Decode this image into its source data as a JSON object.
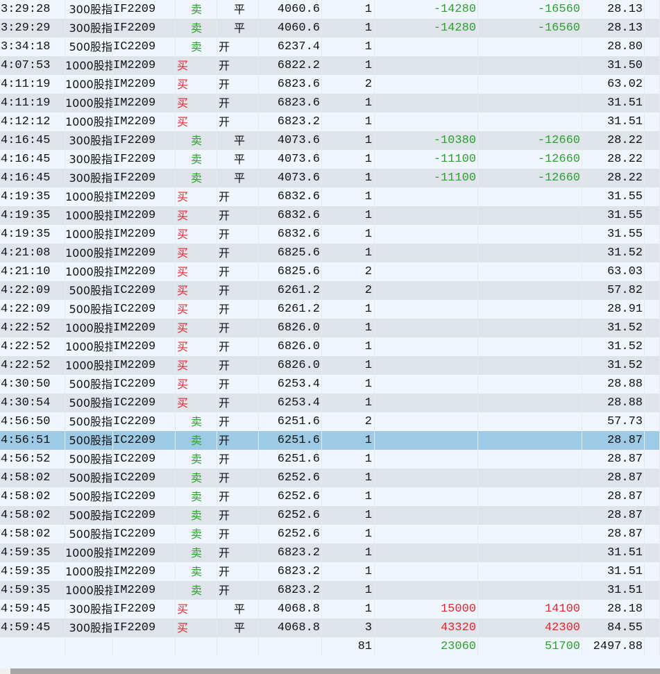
{
  "colors": {
    "buy": "#e8242a",
    "sell": "#2ea02e"
  },
  "rows": [
    [
      "3:29:28",
      "300股指",
      "IF2209",
      "卖",
      "平",
      "4060.6",
      "1",
      "-14280",
      "-16560",
      "28.13"
    ],
    [
      "3:29:29",
      "300股指",
      "IF2209",
      "卖",
      "平",
      "4060.6",
      "1",
      "-14280",
      "-16560",
      "28.13"
    ],
    [
      "3:34:18",
      "500股指",
      "IC2209",
      "卖",
      "开",
      "6237.4",
      "1",
      "",
      "",
      "28.80"
    ],
    [
      "4:07:53",
      "1000股指",
      "IM2209",
      "买",
      "开",
      "6822.2",
      "1",
      "",
      "",
      "31.50"
    ],
    [
      "4:11:19",
      "1000股指",
      "IM2209",
      "买",
      "开",
      "6823.6",
      "2",
      "",
      "",
      "63.02"
    ],
    [
      "4:11:19",
      "1000股指",
      "IM2209",
      "买",
      "开",
      "6823.6",
      "1",
      "",
      "",
      "31.51"
    ],
    [
      "4:12:12",
      "1000股指",
      "IM2209",
      "买",
      "开",
      "6823.2",
      "1",
      "",
      "",
      "31.51"
    ],
    [
      "4:16:45",
      "300股指",
      "IF2209",
      "卖",
      "平",
      "4073.6",
      "1",
      "-10380",
      "-12660",
      "28.22"
    ],
    [
      "4:16:45",
      "300股指",
      "IF2209",
      "卖",
      "平",
      "4073.6",
      "1",
      "-11100",
      "-12660",
      "28.22"
    ],
    [
      "4:16:45",
      "300股指",
      "IF2209",
      "卖",
      "平",
      "4073.6",
      "1",
      "-11100",
      "-12660",
      "28.22"
    ],
    [
      "4:19:35",
      "1000股指",
      "IM2209",
      "买",
      "开",
      "6832.6",
      "1",
      "",
      "",
      "31.55"
    ],
    [
      "4:19:35",
      "1000股指",
      "IM2209",
      "买",
      "开",
      "6832.6",
      "1",
      "",
      "",
      "31.55"
    ],
    [
      "4:19:35",
      "1000股指",
      "IM2209",
      "买",
      "开",
      "6832.6",
      "1",
      "",
      "",
      "31.55"
    ],
    [
      "4:21:08",
      "1000股指",
      "IM2209",
      "买",
      "开",
      "6825.6",
      "1",
      "",
      "",
      "31.52"
    ],
    [
      "4:21:10",
      "1000股指",
      "IM2209",
      "买",
      "开",
      "6825.6",
      "2",
      "",
      "",
      "63.03"
    ],
    [
      "4:22:09",
      "500股指",
      "IC2209",
      "买",
      "开",
      "6261.2",
      "2",
      "",
      "",
      "57.82"
    ],
    [
      "4:22:09",
      "500股指",
      "IC2209",
      "买",
      "开",
      "6261.2",
      "1",
      "",
      "",
      "28.91"
    ],
    [
      "4:22:52",
      "1000股指",
      "IM2209",
      "买",
      "开",
      "6826.0",
      "1",
      "",
      "",
      "31.52"
    ],
    [
      "4:22:52",
      "1000股指",
      "IM2209",
      "买",
      "开",
      "6826.0",
      "1",
      "",
      "",
      "31.52"
    ],
    [
      "4:22:52",
      "1000股指",
      "IM2209",
      "买",
      "开",
      "6826.0",
      "1",
      "",
      "",
      "31.52"
    ],
    [
      "4:30:50",
      "500股指",
      "IC2209",
      "买",
      "开",
      "6253.4",
      "1",
      "",
      "",
      "28.88"
    ],
    [
      "4:30:54",
      "500股指",
      "IC2209",
      "买",
      "开",
      "6253.4",
      "1",
      "",
      "",
      "28.88"
    ],
    [
      "4:56:50",
      "500股指",
      "IC2209",
      "卖",
      "开",
      "6251.6",
      "2",
      "",
      "",
      "57.73"
    ],
    [
      "4:56:51",
      "500股指",
      "IC2209",
      "卖",
      "开",
      "6251.6",
      "1",
      "",
      "",
      "28.87"
    ],
    [
      "4:56:52",
      "500股指",
      "IC2209",
      "卖",
      "开",
      "6251.6",
      "1",
      "",
      "",
      "28.87"
    ],
    [
      "4:58:02",
      "500股指",
      "IC2209",
      "卖",
      "开",
      "6252.6",
      "1",
      "",
      "",
      "28.87"
    ],
    [
      "4:58:02",
      "500股指",
      "IC2209",
      "卖",
      "开",
      "6252.6",
      "1",
      "",
      "",
      "28.87"
    ],
    [
      "4:58:02",
      "500股指",
      "IC2209",
      "卖",
      "开",
      "6252.6",
      "1",
      "",
      "",
      "28.87"
    ],
    [
      "4:58:02",
      "500股指",
      "IC2209",
      "卖",
      "开",
      "6252.6",
      "1",
      "",
      "",
      "28.87"
    ],
    [
      "4:59:35",
      "1000股指",
      "IM2209",
      "卖",
      "开",
      "6823.2",
      "1",
      "",
      "",
      "31.51"
    ],
    [
      "4:59:35",
      "1000股指",
      "IM2209",
      "卖",
      "开",
      "6823.2",
      "1",
      "",
      "",
      "31.51"
    ],
    [
      "4:59:35",
      "1000股指",
      "IM2209",
      "卖",
      "开",
      "6823.2",
      "1",
      "",
      "",
      "31.51"
    ],
    [
      "4:59:45",
      "300股指",
      "IF2209",
      "买",
      "平",
      "4068.8",
      "1",
      "15000",
      "14100",
      "28.18"
    ],
    [
      "4:59:45",
      "300股指",
      "IF2209",
      "买",
      "平",
      "4068.8",
      "3",
      "43320",
      "42300",
      "84.55"
    ]
  ],
  "selected_row": 23,
  "totals": {
    "qty": "81",
    "profit1": "23060",
    "profit2": "51700",
    "fee": "2497.88"
  }
}
